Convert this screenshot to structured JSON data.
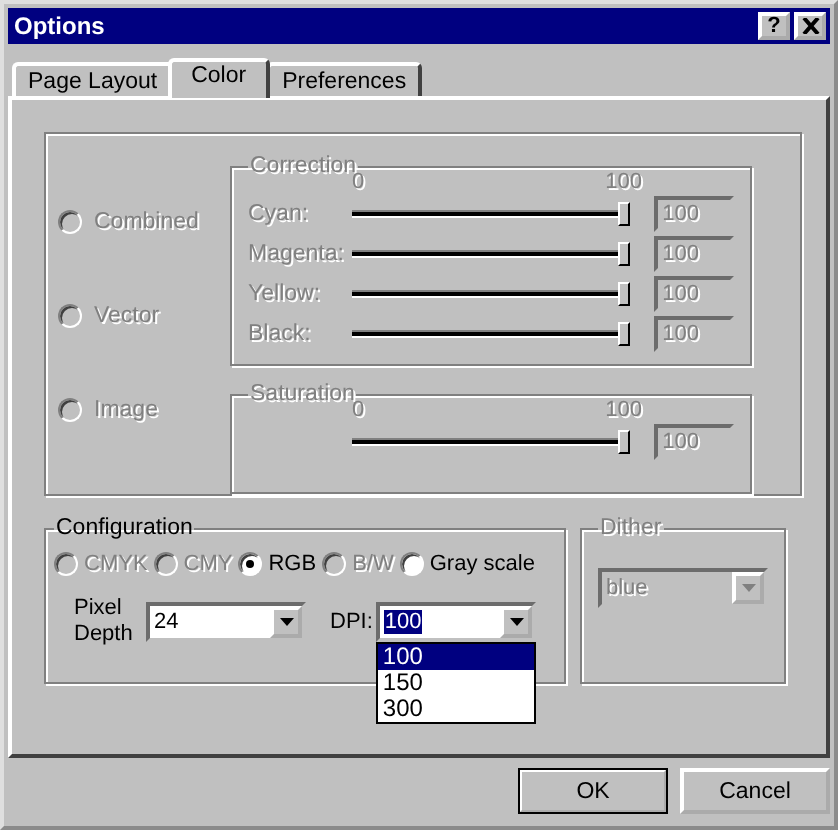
{
  "window": {
    "title": "Options",
    "help_button": "?"
  },
  "tabs": [
    {
      "label": "Page Layout",
      "selected": false
    },
    {
      "label": "Color",
      "selected": true
    },
    {
      "label": "Preferences",
      "selected": false
    }
  ],
  "color_modes": [
    {
      "label": "Combined",
      "selected": false,
      "disabled": true
    },
    {
      "label": "Vector",
      "selected": false,
      "disabled": true
    },
    {
      "label": "Image",
      "selected": false,
      "disabled": true
    }
  ],
  "correction": {
    "title": "Correction",
    "scale_min": "0",
    "scale_max": "100",
    "disabled": true,
    "channels": [
      {
        "label": "Cyan:",
        "level": 1,
        "value": "100"
      },
      {
        "label": "Magenta:",
        "level": 1,
        "value": "100"
      },
      {
        "label": "Yellow:",
        "level": 1,
        "value": "100"
      },
      {
        "label": "Black:",
        "level": 1,
        "value": "100"
      }
    ]
  },
  "saturation": {
    "title": "Saturation",
    "scale_min": "0",
    "scale_max": "100",
    "disabled": true,
    "level": 1,
    "value": "100"
  },
  "configuration": {
    "title": "Configuration",
    "options": [
      {
        "label": "CMYK",
        "selected": false,
        "disabled": true
      },
      {
        "label": "CMY",
        "selected": false,
        "disabled": true
      },
      {
        "label": "RGB",
        "selected": true,
        "disabled": false
      },
      {
        "label": "B/W",
        "selected": false,
        "disabled": true
      },
      {
        "label": "Gray scale",
        "selected": false,
        "disabled": false
      }
    ],
    "pixel_depth": {
      "label": "Pixel Depth",
      "value": "24"
    },
    "dpi": {
      "label": "DPI:",
      "value": "100",
      "expanded": true,
      "options": [
        {
          "label": "100",
          "selected": true
        },
        {
          "label": "150",
          "selected": false
        },
        {
          "label": "300",
          "selected": false
        }
      ]
    }
  },
  "dither": {
    "title": "Dither",
    "value": "blue",
    "disabled": true
  },
  "buttons": [
    {
      "label": "OK",
      "default": true
    },
    {
      "label": "Cancel",
      "default": false
    }
  ]
}
